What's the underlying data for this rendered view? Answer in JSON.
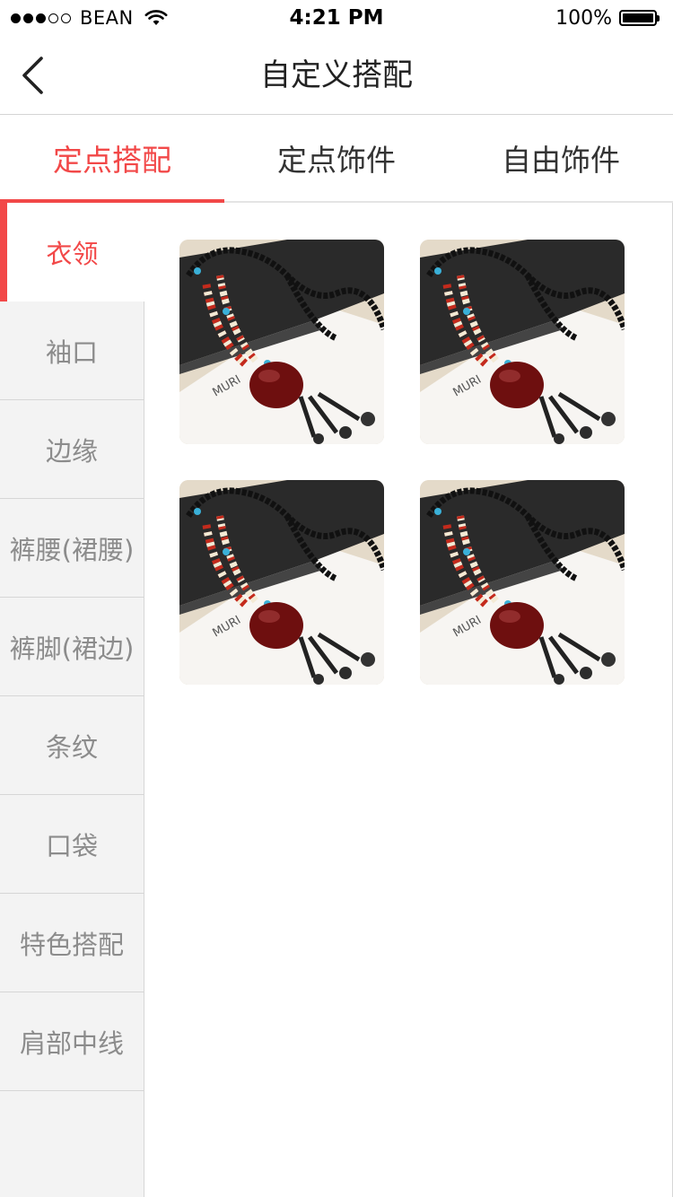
{
  "status_bar": {
    "carrier": "BEAN",
    "time": "4:21 PM",
    "battery": "100%"
  },
  "nav": {
    "title": "自定义搭配"
  },
  "tabs": [
    {
      "label": "定点搭配",
      "active": true
    },
    {
      "label": "定点饰件",
      "active": false
    },
    {
      "label": "自由饰件",
      "active": false
    }
  ],
  "sidebar": {
    "items": [
      {
        "label": "衣领",
        "active": true
      },
      {
        "label": "袖口"
      },
      {
        "label": "边缘"
      },
      {
        "label": "裤腰(裙腰)"
      },
      {
        "label": "裤脚(裙边)"
      },
      {
        "label": "条纹"
      },
      {
        "label": "口袋"
      },
      {
        "label": "特色搭配"
      },
      {
        "label": "肩部中线"
      }
    ]
  },
  "products": [
    {
      "image": "necklace-photo"
    },
    {
      "image": "necklace-photo"
    },
    {
      "image": "necklace-photo"
    },
    {
      "image": "necklace-photo"
    }
  ],
  "colors": {
    "accent": "#f24848",
    "sidebar_bg": "#f3f3f3",
    "sidebar_text": "#8c8c8c"
  }
}
